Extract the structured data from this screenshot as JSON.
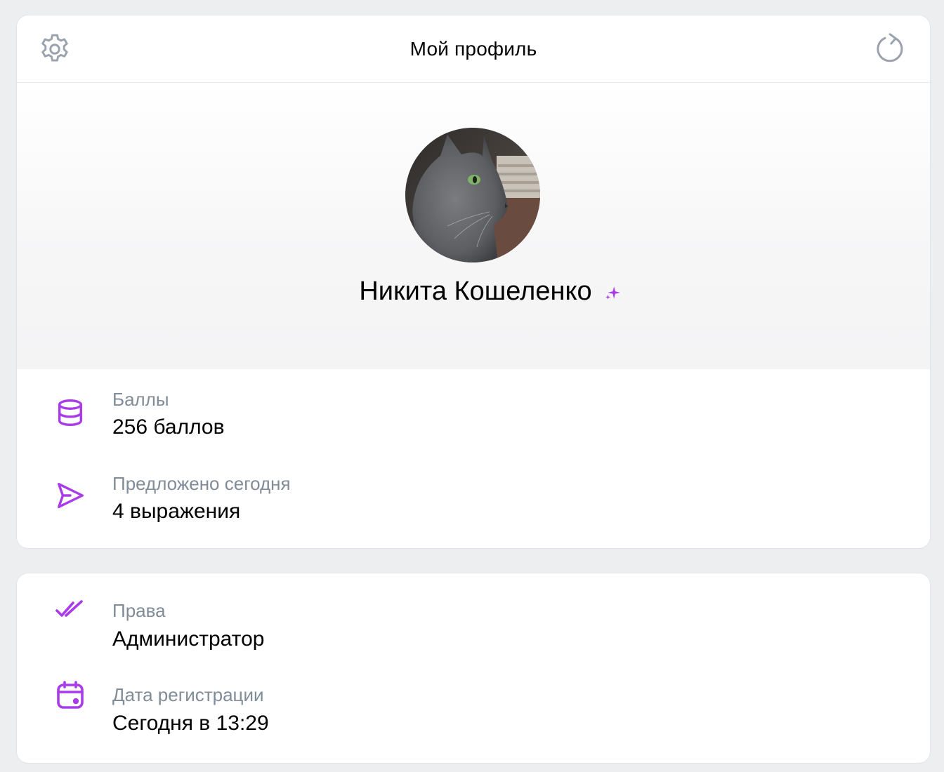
{
  "header": {
    "title": "Мой профиль",
    "settings_icon": "gear-icon",
    "refresh_icon": "refresh-icon"
  },
  "profile": {
    "name": "Никита Кошеленко",
    "badge_icon": "sparkle-icon",
    "avatar": "cat-photo"
  },
  "stats": [
    {
      "icon": "coins-stack-icon",
      "label": "Баллы",
      "value": "256 баллов"
    },
    {
      "icon": "send-icon",
      "label": "Предложено сегодня",
      "value": "4 выражения"
    }
  ],
  "details": [
    {
      "icon": "double-check-icon",
      "label": "Права",
      "value": "Администратор"
    },
    {
      "icon": "calendar-icon",
      "label": "Дата регистрации",
      "value": "Сегодня в 13:29"
    }
  ],
  "colors": {
    "accent": "#a93ce8",
    "label": "#818c99",
    "icon_gray": "#99a2ad",
    "background": "#edeef0"
  }
}
